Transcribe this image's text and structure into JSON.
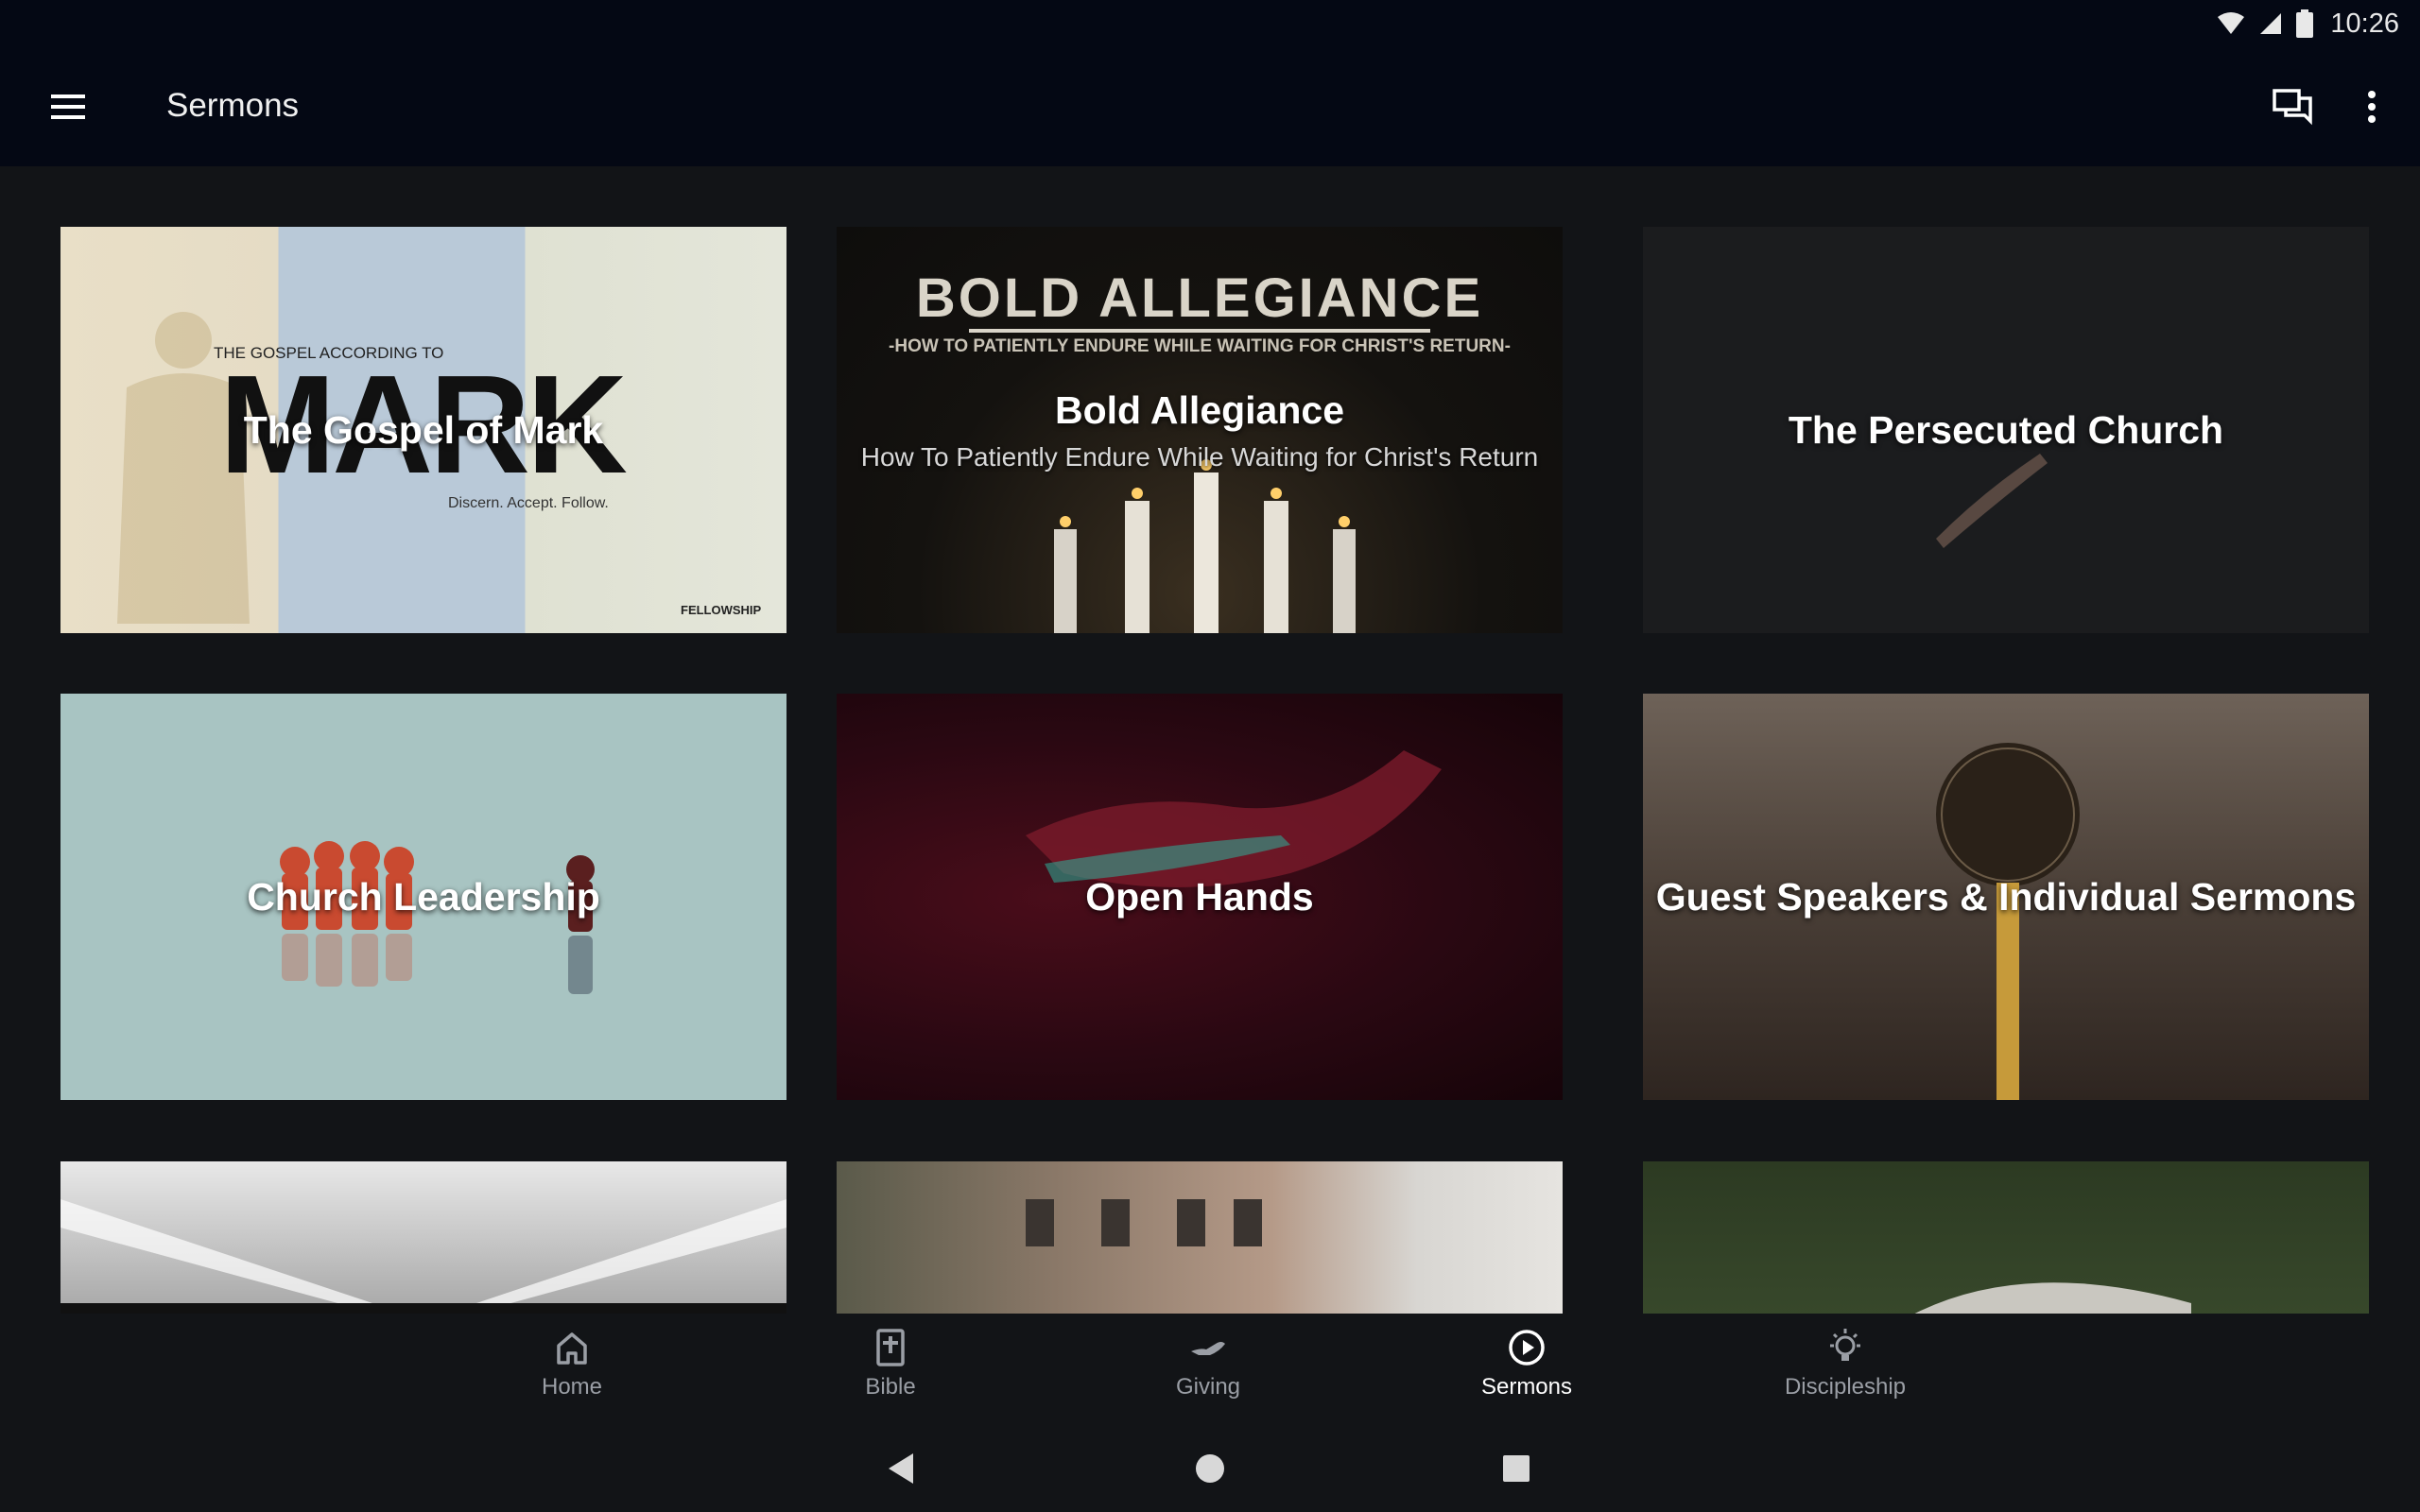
{
  "status_bar": {
    "time": "10:26"
  },
  "app_bar": {
    "title": "Sermons"
  },
  "sermon_series": [
    {
      "title": "The Gospel of Mark",
      "subtitle": ""
    },
    {
      "title": "Bold Allegiance",
      "subtitle": "How To Patiently Endure While Waiting for Christ's Return"
    },
    {
      "title": "The Persecuted Church",
      "subtitle": ""
    },
    {
      "title": "Church Leadership",
      "subtitle": ""
    },
    {
      "title": "Open Hands",
      "subtitle": ""
    },
    {
      "title": "Guest Speakers & Individual Sermons",
      "subtitle": ""
    },
    {
      "title": "",
      "subtitle": ""
    },
    {
      "title": "",
      "subtitle": ""
    },
    {
      "title": "",
      "subtitle": ""
    }
  ],
  "artwork_text": {
    "mark_kicker": "THE GOSPEL ACCORDING TO",
    "mark_word": "MARK",
    "mark_tagline": "Discern. Accept. Follow.",
    "mark_logo": "FELLOWSHIP",
    "bold_heading": "BOLD ALLEGIANCE",
    "bold_subheading": "-HOW TO PATIENTLY ENDURE WHILE WAITING FOR CHRIST'S RETURN-"
  },
  "bottom_nav": [
    {
      "label": "Home",
      "icon": "home-icon",
      "active": false
    },
    {
      "label": "Bible",
      "icon": "bible-icon",
      "active": false
    },
    {
      "label": "Giving",
      "icon": "giving-icon",
      "active": false
    },
    {
      "label": "Sermons",
      "icon": "play-circle-icon",
      "active": true
    },
    {
      "label": "Discipleship",
      "icon": "lightbulb-icon",
      "active": false
    }
  ],
  "colors": {
    "app_bar": "#040814",
    "background": "#121417",
    "nav_inactive": "#9a9ea5",
    "nav_active": "#ffffff"
  }
}
